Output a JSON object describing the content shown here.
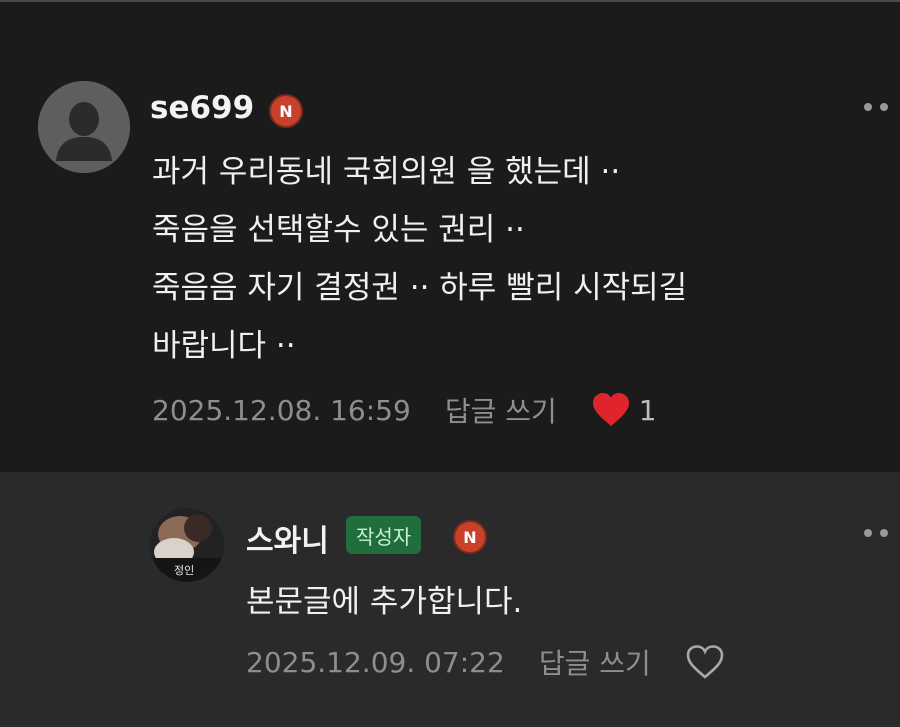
{
  "comments": [
    {
      "username": "se699",
      "n_badge": "N",
      "lines": [
        "과거 우리동네 국회의원 을 했는데 ··",
        "죽음을 선택할수 있는 권리 ··",
        "죽음음 자기 결정권 ·· 하루 빨리 시작되길",
        "바랍니다 ··"
      ],
      "timestamp": "2025.12.08. 16:59",
      "reply_label": "답글 쓰기",
      "liked": true,
      "like_count": "1",
      "like_color": "#e0242d"
    },
    {
      "username": "스와니",
      "author_badge": "작성자",
      "n_badge": "N",
      "lines": [
        "본문글에 추가합니다."
      ],
      "timestamp": "2025.12.09. 07:22",
      "reply_label": "답글 쓰기",
      "liked": false,
      "avatar_text": "정인"
    }
  ],
  "icons": {
    "default_avatar": "person-silhouette-icon",
    "more": "more-dots-icon",
    "like_filled": "heart-filled-icon",
    "like_outline": "heart-outline-icon"
  }
}
